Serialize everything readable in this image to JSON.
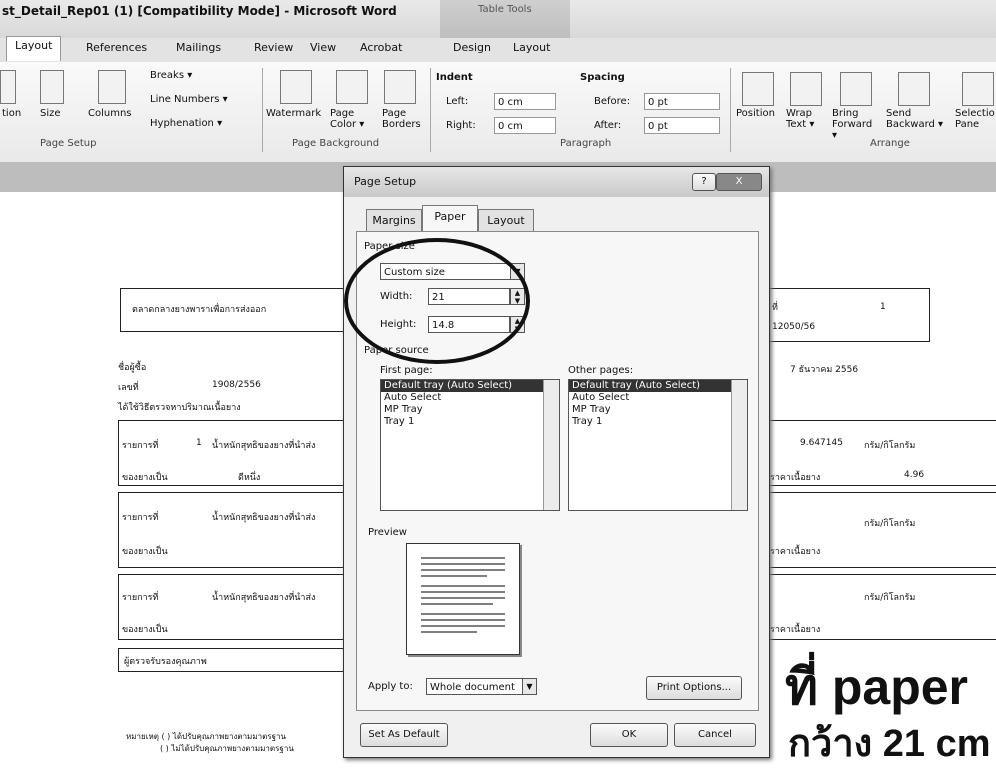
{
  "window": {
    "title": "st_Detail_Rep01 (1) [Compatibility Mode] - Microsoft Word",
    "contextual_group": "Table Tools"
  },
  "ribbon_tabs": [
    "Layout",
    "References",
    "Mailings",
    "Review",
    "View",
    "Acrobat",
    "Design",
    "Layout"
  ],
  "ribbon": {
    "page_setup": {
      "orientation": "tion",
      "size": "Size",
      "columns": "Columns",
      "breaks": "Breaks ▾",
      "line_numbers": "Line Numbers ▾",
      "hyphenation": "Hyphenation ▾",
      "group_label": "Page Setup"
    },
    "page_background": {
      "watermark": "Watermark",
      "page_color": "Page Color ▾",
      "page_borders": "Page Borders",
      "group_label": "Page Background"
    },
    "paragraph": {
      "indent": "Indent",
      "left_label": "Left:",
      "left_value": "0 cm",
      "right_label": "Right:",
      "right_value": "0 cm",
      "spacing": "Spacing",
      "before_label": "Before:",
      "before_value": "0 pt",
      "after_label": "After:",
      "after_value": "0 pt",
      "group_label": "Paragraph"
    },
    "arrange": {
      "position": "Position",
      "wrap_text": "Wrap Text ▾",
      "bring_forward": "Bring Forward ▾",
      "send_backward": "Send Backward ▾",
      "selection_pane": "Selection Pane",
      "group_label": "Arrange"
    }
  },
  "dialog": {
    "title": "Page Setup",
    "help": "?",
    "close": "X",
    "tabs": [
      "Margins",
      "Paper",
      "Layout"
    ],
    "paper_size_label": "Paper size",
    "paper_size_value": "Custom size",
    "width_label": "Width:",
    "width_value": "21",
    "height_label": "Height:",
    "height_value": "14.8",
    "paper_source_label": "Paper source",
    "first_page_label": "First page:",
    "other_pages_label": "Other pages:",
    "first_page_options": [
      "Default tray (Auto Select)",
      "Auto Select",
      "MP Tray",
      "Tray 1"
    ],
    "other_pages_options": [
      "Default tray (Auto Select)",
      "Auto Select",
      "MP Tray",
      "Tray 1"
    ],
    "preview_label": "Preview",
    "apply_to_label": "Apply to:",
    "apply_to_value": "Whole document",
    "print_options": "Print Options...",
    "set_as_default": "Set As Default",
    "ok": "OK",
    "cancel": "Cancel"
  },
  "document": {
    "right_col": {
      "label_top": "ที่",
      "number": "1",
      "ref": "12050/56",
      "date": "7 ธันวาคม 2556",
      "value": "9.647145",
      "unit": "กรัม/กิโลกรัม",
      "value2": "4.96",
      "unit2": "กรัม/กิโลกรัม",
      "unit3": "กรัม/กิโลกรัม",
      "row_label": "ราคาเนื้อยาง"
    },
    "left_col": {
      "header": "ตลาดกลางยางพาราเพื่อการส่งออก",
      "r1": "ชื่อผู้ซื้อ",
      "r2": "เลขที่",
      "r2v": "1908/2556",
      "r3": "ได้ใช้วิธีตรวจหาปริมาณเนื้อยาง",
      "box1a": "รายการที่",
      "box1n": "1",
      "box1b": "น้ำหนักสุทธิของยางที่นำส่ง",
      "box1c": "ของยางเป็น",
      "box1d": "ดีหนึ่ง",
      "box2a": "รายการที่",
      "box2b": "น้ำหนักสุทธิของยางที่นำส่ง",
      "box2c": "ของยางเป็น",
      "box3a": "รายการที่",
      "box3b": "น้ำหนักสุทธิของยางที่นำส่ง",
      "box3c": "ของยางเป็น",
      "footer": "ผู้ตรวจรับรองคุณภาพ",
      "note1": "หมายเหตุ ( ) ได้ปรับคุณภาพยางตามมาตรฐาน",
      "note2": "( ) ไม่ได้ปรับคุณภาพยางตามมาตรฐาน"
    }
  },
  "overlay_text": {
    "line1": "ที่ paper",
    "line2": "กว้าง 21 cm"
  }
}
